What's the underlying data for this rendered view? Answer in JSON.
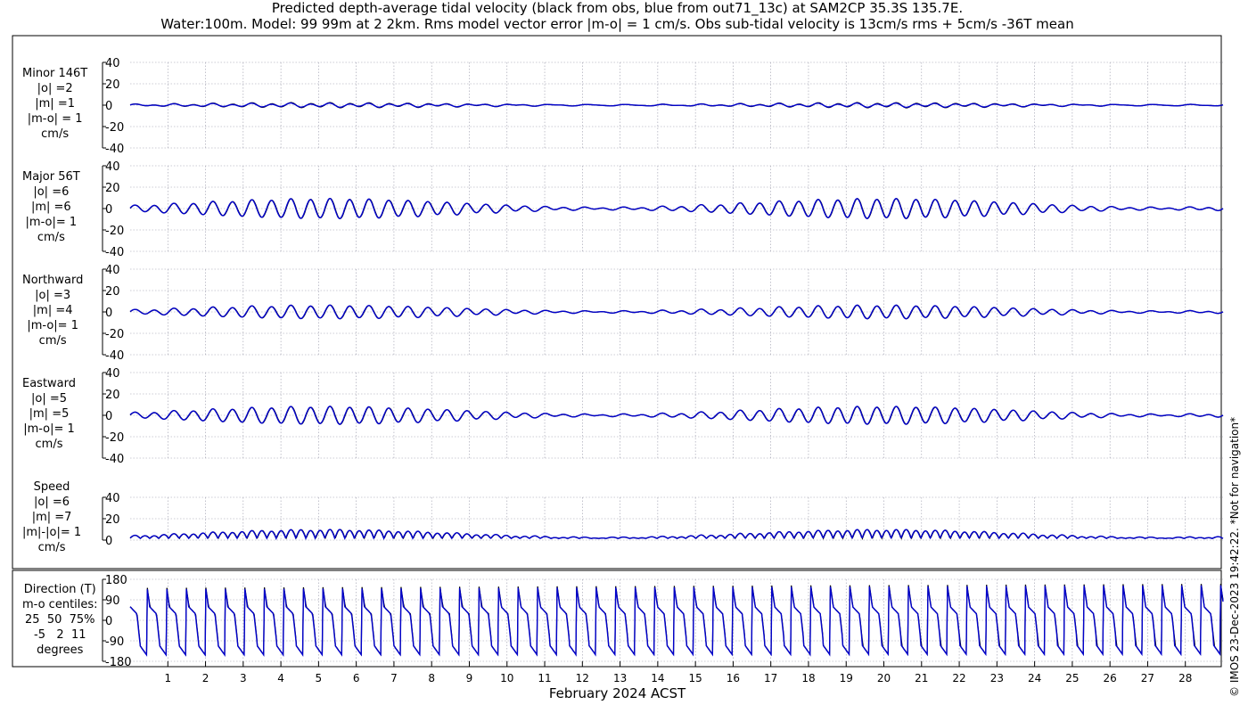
{
  "title": {
    "line1": "Predicted depth-average tidal velocity (black from obs, blue from out71_13c) at SAM2CP 35.3S 135.7E.",
    "line2": "Water:100m. Model: 99 99m at 2 2km. Rms model vector error |m-o| = 1 cm/s. Obs sub-tidal velocity is 13cm/s rms + 5cm/s -36T mean"
  },
  "xlabel": "February 2024 ACST",
  "credit": "© IMOS 23-Dec-2023 19:42:22. *Not for navigation*",
  "colors": {
    "obs": "#000000",
    "model": "#0000cc",
    "grid": "#9a9aaa"
  },
  "chart_data": [
    {
      "type": "line",
      "id": "minor",
      "label_lines": [
        "Minor 146T",
        "|o| =2",
        "|m| =1",
        "|m-o| = 1",
        "cm/s"
      ],
      "yticks": [
        40,
        20,
        0,
        -20,
        -40
      ],
      "ylim": [
        -40,
        40
      ],
      "x": {
        "start_day": 0,
        "end_day": 29,
        "tick_labels": [
          "1",
          "2",
          "3",
          "4",
          "5",
          "6",
          "7",
          "8",
          "9",
          "10",
          "11",
          "12",
          "13",
          "14",
          "15",
          "16",
          "17",
          "18",
          "19",
          "20",
          "21",
          "22",
          "23",
          "24",
          "25",
          "26",
          "27",
          "28"
        ]
      },
      "series": [
        {
          "role": "obs",
          "amplitude": 2
        },
        {
          "role": "model",
          "amplitude": 1.5
        }
      ]
    },
    {
      "type": "line",
      "id": "major",
      "label_lines": [
        "Major 56T",
        "|o| =6",
        "|m| =6",
        "|m-o|= 1",
        "cm/s"
      ],
      "yticks": [
        40,
        20,
        0,
        -20,
        -40
      ],
      "ylim": [
        -40,
        40
      ],
      "series": [
        {
          "role": "obs",
          "amplitude": 9
        },
        {
          "role": "model",
          "amplitude": 9
        }
      ]
    },
    {
      "type": "line",
      "id": "north",
      "label_lines": [
        "Northward",
        "|o| =3",
        "|m| =4",
        "|m-o|= 1",
        "cm/s"
      ],
      "yticks": [
        40,
        20,
        0,
        -20,
        -40
      ],
      "ylim": [
        -40,
        40
      ],
      "series": [
        {
          "role": "obs",
          "amplitude": 6
        },
        {
          "role": "model",
          "amplitude": 6
        }
      ]
    },
    {
      "type": "line",
      "id": "east",
      "label_lines": [
        "Eastward",
        "|o| =5",
        "|m| =5",
        "|m-o|= 1",
        "cm/s"
      ],
      "yticks": [
        40,
        20,
        0,
        -20,
        -40
      ],
      "ylim": [
        -40,
        40
      ],
      "series": [
        {
          "role": "obs",
          "amplitude": 8
        },
        {
          "role": "model",
          "amplitude": 8
        }
      ]
    },
    {
      "type": "line",
      "id": "speed",
      "label_lines": [
        "Speed",
        "|o| =6",
        "|m| =7",
        "|m|-|o|= 1",
        "cm/s"
      ],
      "yticks": [
        40,
        20,
        0
      ],
      "ylim": [
        0,
        40
      ],
      "series": [
        {
          "role": "obs",
          "amplitude": 8
        },
        {
          "role": "model",
          "amplitude": 8
        }
      ]
    },
    {
      "type": "line",
      "id": "direction",
      "label_lines": [
        "Direction (T)",
        "m-o centiles:",
        "25  50  75%",
        "-5   2  11",
        "degrees"
      ],
      "yticks": [
        180,
        90,
        0,
        -90,
        -180
      ],
      "ylim": [
        -180,
        180
      ],
      "series": [
        {
          "role": "obs"
        },
        {
          "role": "model"
        }
      ]
    }
  ]
}
